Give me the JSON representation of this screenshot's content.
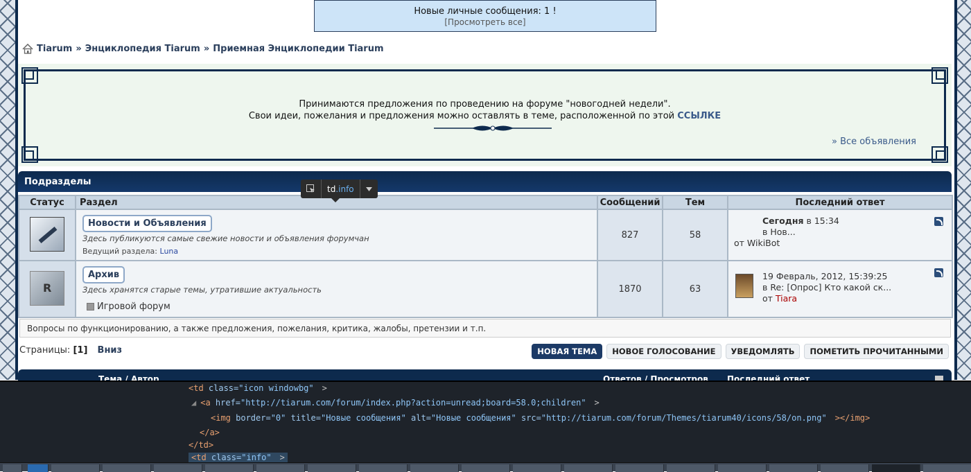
{
  "pm": {
    "title": "Новые личные сообщения: 1 !",
    "view_all": "[Просмотреть все]"
  },
  "breadcrumb": {
    "items": [
      "Tiarum",
      "Энциклопедия Tiarum",
      "Приемная Энциклопедии Tiarum"
    ],
    "sep": "»"
  },
  "news": {
    "line1": "Принимаются предложения по проведению на форуме \"новогодней недели\".",
    "line2_prefix": "Свои идеи, пожелания и предложения можно оставлять в теме, расположенной по этой ",
    "line2_link": "ССЫЛКЕ",
    "all_link": "» Все объявления"
  },
  "category": {
    "title": "Подразделы"
  },
  "table": {
    "headers": {
      "status": "Статус",
      "section": "Раздел",
      "posts": "Сообщений",
      "topics": "Тем",
      "last": "Последний ответ"
    },
    "boards": [
      {
        "name": "Новости и Объявления",
        "desc": "Здесь публикуются самые свежие новости и объявления форумчан",
        "mod_label": "Ведущий раздела:",
        "mod_name": "Luna",
        "posts": "827",
        "topics": "58",
        "last_title_bold": "Сегодня",
        "last_title_rest": " в 15:34",
        "last_in": "в Нов...",
        "last_by_prefix": "от ",
        "last_by": "WikiBot"
      },
      {
        "name": "Архив",
        "desc": "Здесь хранятся старые темы, утратившие актуальность",
        "child": "Игровой форум",
        "posts": "1870",
        "topics": "63",
        "last_date": "19 Февраль, 2012, 15:39:25",
        "last_in": "в Re: [Опрос] Кто какой ск...",
        "last_by_prefix": "от ",
        "last_by": "Tiara"
      }
    ]
  },
  "tooltip": {
    "tag": "td",
    "cls": ".info"
  },
  "info_bar": "Вопросы по функционированию, а также предложения, пожелания, критика, жалобы, претензии и т.п.",
  "pages": {
    "label": "Страницы:",
    "current": "[1]",
    "down": "Вниз"
  },
  "buttons": [
    "НОВАЯ ТЕМА",
    "НОВОЕ ГОЛОСОВАНИЕ",
    "УВЕДОМЛЯТЬ",
    "ПОМЕТИТЬ ПРОЧИТАННЫМИ"
  ],
  "topic_header": {
    "col1": "Тема / Автор",
    "col2": "Ответов / Просмотров",
    "col3": "Последний ответ"
  },
  "devtools": {
    "line1_tag": "<td",
    "line1_attr": " class=",
    "line1_val": "\"icon windowbg\"",
    "line1_end": ">",
    "line2_tag": "<a",
    "line2_attr": " href=",
    "line2_val": "\"http://tiarum.com/forum/index.php?action=unread;board=58.0;children\"",
    "line2_end": ">",
    "line3_tag": "<img",
    "line3_a1": " border=",
    "line3_v1": "\"0\"",
    "line3_a2": " title=",
    "line3_v2": "\"Новые сообщения\"",
    "line3_a3": " alt=",
    "line3_v3": "\"Новые сообщения\"",
    "line3_a4": " src=",
    "line3_v4": "\"http://tiarum.com/forum/Themes/tiarum40/icons/58/on.png\"",
    "line3_end": "></img>",
    "line4": "</a>",
    "line5": "</td>",
    "line6_tag": "<td",
    "line6_attr": " class=",
    "line6_val": "\"info\"",
    "line6_end": ">"
  }
}
